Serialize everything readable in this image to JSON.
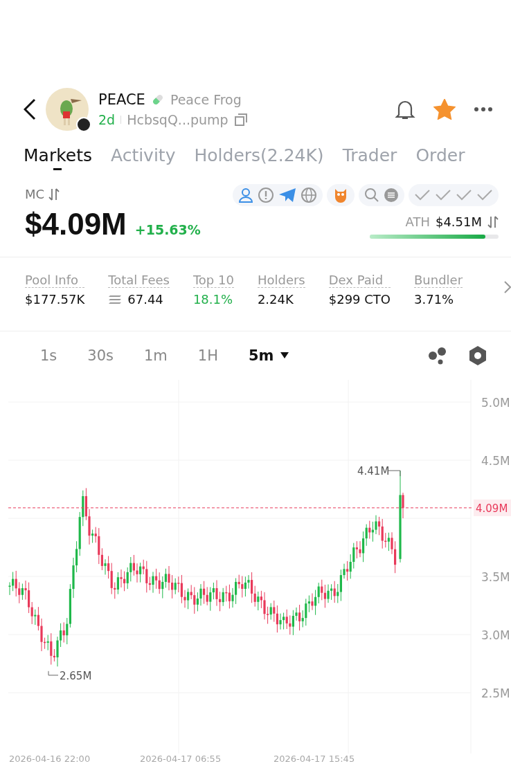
{
  "header": {
    "symbol": "PEACE",
    "name": "Peace Frog",
    "age": "2d",
    "address": "HcbsqQ...pump",
    "starred": true
  },
  "tabs": [
    {
      "label": "Markets",
      "selected": true
    },
    {
      "label": "Activity",
      "selected": false
    },
    {
      "label": "Holders(2.24K)",
      "selected": false
    },
    {
      "label": "Trader",
      "selected": false
    },
    {
      "label": "Order",
      "selected": false
    }
  ],
  "market": {
    "label": "MC",
    "value": "$4.09M",
    "change": "+15.63%",
    "ath_label": "ATH",
    "ath_value": "$4.51M",
    "level": 0.9
  },
  "stats": [
    {
      "label": "Pool Info",
      "value": "$177.57K",
      "kind": "plain"
    },
    {
      "label": "Total Fees",
      "value": "67.44",
      "kind": "fee"
    },
    {
      "label": "Top 10",
      "value": "18.1%",
      "kind": "positive"
    },
    {
      "label": "Holders",
      "value": "2.24K",
      "kind": "plain"
    },
    {
      "label": "Dex Paid",
      "value": "$299 CTO",
      "kind": "plain"
    },
    {
      "label": "Bundler",
      "value": "3.71%",
      "kind": "plain"
    }
  ],
  "intervals": [
    {
      "label": "1s",
      "selected": false
    },
    {
      "label": "30s",
      "selected": false
    },
    {
      "label": "1m",
      "selected": false
    },
    {
      "label": "1H",
      "selected": false
    },
    {
      "label": "5m",
      "selected": true
    }
  ],
  "chart": {
    "y_labels": [
      "5.0M",
      "4.5M",
      "3.5M",
      "3.0M",
      "2.5M"
    ],
    "x_labels": [
      "2026-04-16 22:00",
      "2026-04-17 06:55",
      "2026-04-17 15:45"
    ],
    "high_label": "4.41M",
    "low_label": "2.65M",
    "price_label": "4.09M"
  }
}
